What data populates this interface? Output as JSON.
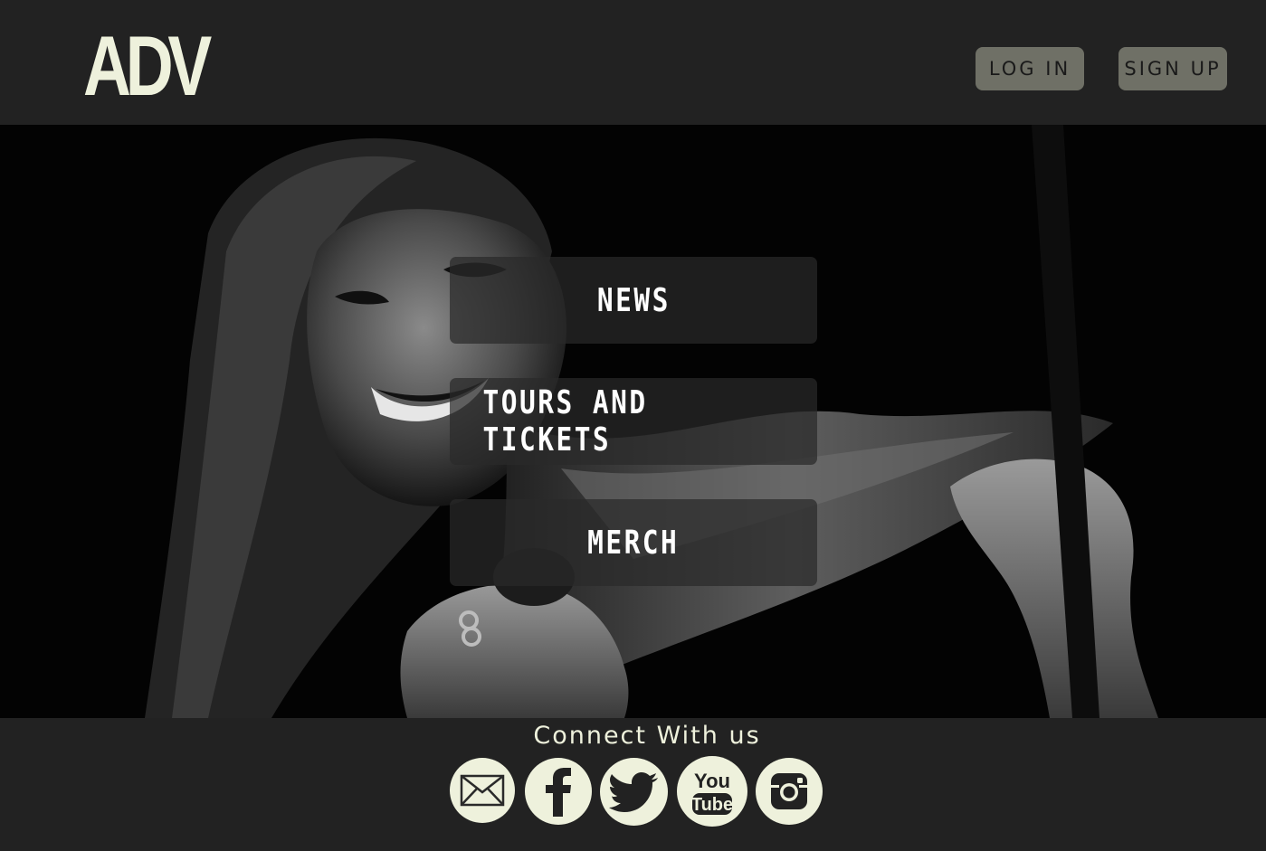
{
  "header": {
    "logo": "ADV",
    "login_label": "LOG IN",
    "signup_label": "SIGN UP"
  },
  "menu": {
    "items": [
      {
        "label": "NEWS"
      },
      {
        "label": "TOURS AND TICKETS"
      },
      {
        "label": "MERCH"
      }
    ]
  },
  "footer": {
    "connect_title": "Connect With us",
    "social": [
      {
        "icon": "email-icon"
      },
      {
        "icon": "facebook-icon"
      },
      {
        "icon": "twitter-icon"
      },
      {
        "icon": "youtube-icon",
        "text_top": "You",
        "text_bottom": "Tube"
      },
      {
        "icon": "instagram-icon"
      }
    ]
  },
  "colors": {
    "background": "#222222",
    "accent": "#eef1dc",
    "button": "#6f7066"
  }
}
